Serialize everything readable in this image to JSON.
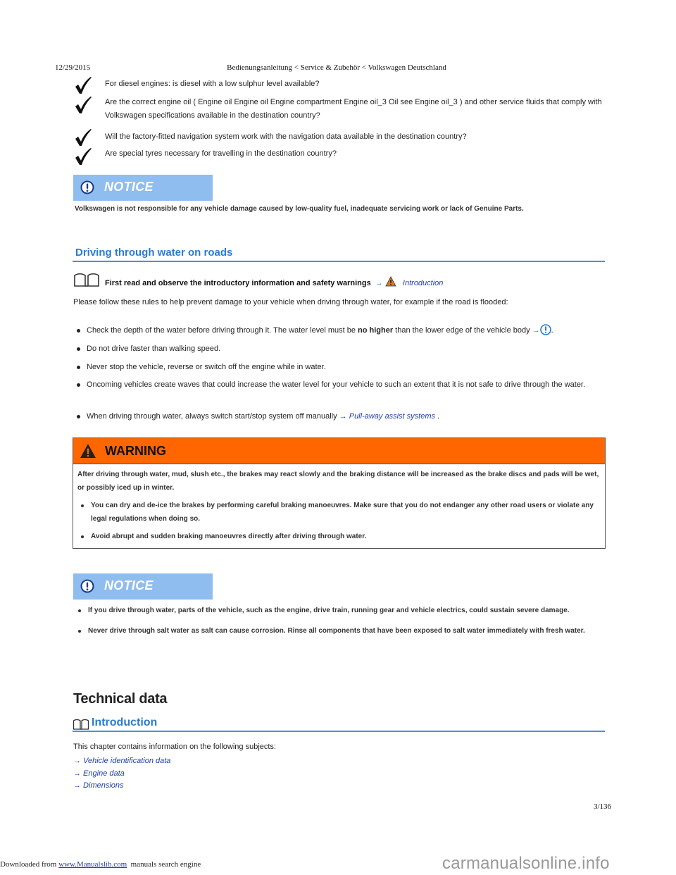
{
  "header": {
    "date": "12/29/2015",
    "title": "Bedienungsanleitung < Service & Zubehör < Volkswagen Deutschland"
  },
  "checklist": [
    {
      "icon": "checkmark-icon",
      "text": "For diesel engines: is diesel with a low sulphur level available?"
    },
    {
      "icon": "checkmark-icon",
      "text": "Are the correct engine oil ( Engine oil Engine oil Engine compartment Engine oil_3 Oil see Engine oil_3 ) and other service fluids that comply with Volkswagen specifications available in the destination country?"
    },
    {
      "icon": "checkmark-icon",
      "text": "Will the factory-fitted navigation system work with the navigation data available in the destination country?"
    },
    {
      "icon": "checkmark-icon",
      "text": "Are special tyres necessary for travelling in the destination country?"
    }
  ],
  "notice1": {
    "label": "NOTICE",
    "icon": "exclamation-circle-icon",
    "text": "Volkswagen is not responsible for any vehicle damage caused by low-quality fuel, inadequate servicing work or lack of Genuine Parts."
  },
  "section": {
    "title": "Driving through water on roads",
    "intro_text": "First read and observe the introductory information and safety warnings",
    "intro_arrow": "→",
    "intro_link": "Introduction",
    "paragraph": "Please follow these rules to help prevent damage to your vehicle when driving through water, for example if the road is flooded:",
    "bullets": {
      "b1_pre": "Check the depth of the water before driving through it. The water level must be ",
      "b1_bold": "no higher",
      "b1_post": " than the lower edge of the vehicle body ",
      "b1_arrow": "→",
      "b1_end": ".",
      "b2": "Do not drive faster than walking speed.",
      "b3": "Never stop the vehicle, reverse or switch off the engine while in water.",
      "b4": "Oncoming vehicles create waves that could increase the water level for your vehicle to such an extent that it is not safe to drive through the water.",
      "b5_pre": "When driving through water, always switch start/stop system off manually ",
      "b5_link": "→ Pull-away assist systems",
      "b5_end": " ."
    }
  },
  "warning": {
    "label": "WARNING",
    "icon": "warning-triangle-icon",
    "text": "After driving through water, mud, slush etc., the brakes may react slowly and the braking distance will be increased as the brake discs and pads will be wet, or possibly iced up in winter.",
    "bullets": [
      "You can dry and de-ice the brakes by performing careful braking manoeuvres. Make sure that you do not endanger any other road users or violate any legal regulations when doing so.",
      "Avoid abrupt and sudden braking manoeuvres directly after driving through water."
    ]
  },
  "notice2": {
    "label": "NOTICE",
    "icon": "exclamation-circle-icon",
    "bullets": [
      "If you drive through water, parts of the vehicle, such as the engine, drive train, running gear and vehicle electrics, could sustain severe damage.",
      "Never drive through salt water as salt can cause corrosion. Rinse all components that have been exposed to salt water immediately with fresh water."
    ]
  },
  "technical": {
    "heading": "Technical data",
    "intro_title": "Introduction",
    "chapter_text": "This chapter contains information on the following subjects:",
    "links": [
      "→ Vehicle identification data",
      "→ Engine data",
      "→ Dimensions"
    ]
  },
  "page_number": "3/136",
  "footer": {
    "pre": "Downloaded from ",
    "link": "www.Manualslib.com",
    "post": "  manuals search engine",
    "watermark": "carmanualsonline.info"
  },
  "colors": {
    "notice_bg": "#8fbdef",
    "warning_bg": "#ff6600",
    "heading_blue": "#2b7bd0",
    "link_blue": "#1f3fa8"
  }
}
